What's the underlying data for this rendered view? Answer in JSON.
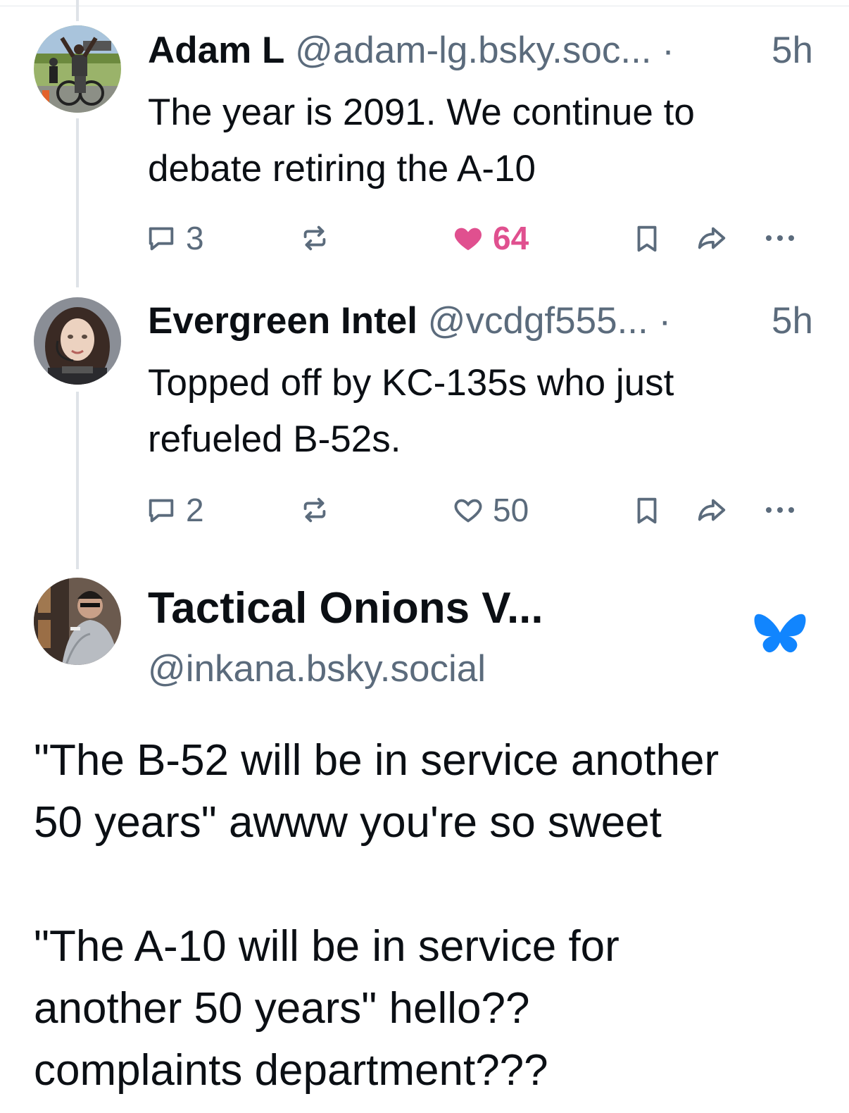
{
  "thread": {
    "posts": [
      {
        "display_name": "Adam L",
        "handle": "@adam-lg.bsky.soc...",
        "separator": "·",
        "time": "5h",
        "text_lines": [
          "The year is 2091. We continue to",
          "debate retiring the A-10"
        ],
        "reply_count": "3",
        "like_count": "64",
        "liked": true
      },
      {
        "display_name": "Evergreen Intel",
        "handle": "@vcdgf555...",
        "separator": "·",
        "time": "5h",
        "text_lines": [
          "Topped off by KC-135s who just",
          "refueled B-52s."
        ],
        "reply_count": "2",
        "like_count": "50",
        "liked": false
      }
    ]
  },
  "main_post": {
    "display_name": "Tactical Onions V...",
    "handle": "@inkana.bsky.social",
    "paragraphs": [
      [
        "\"The B-52 will be in service another",
        "50 years\" awww you're so sweet"
      ],
      [
        "\"The A-10 will be in service for",
        "another 50 years\" hello??",
        "complaints department???"
      ]
    ]
  },
  "colors": {
    "text": "#0b0f14",
    "muted": "#5b6b7c",
    "like_active": "#e0508f",
    "bluesky_blue": "#1185fe",
    "thread_line": "#dfe3e8"
  },
  "icons": {
    "reply": "reply-bubble-icon",
    "repost": "repost-icon",
    "like": "heart-icon",
    "bookmark": "bookmark-icon",
    "share": "share-arrow-icon",
    "more": "more-dots-icon",
    "brand": "bluesky-butterfly-icon"
  }
}
